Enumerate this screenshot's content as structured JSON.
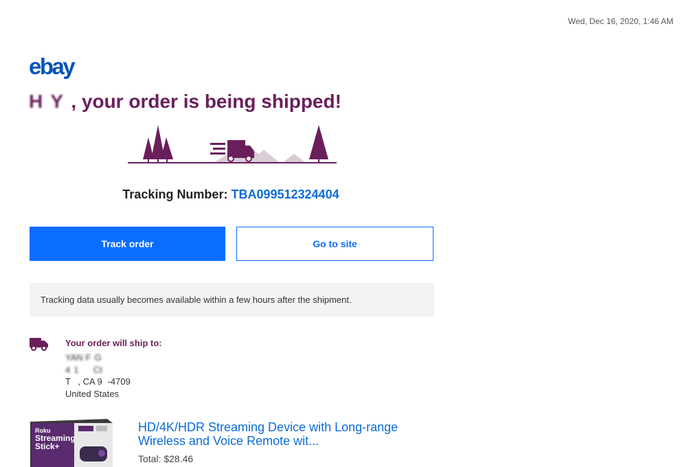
{
  "timestamp": "Wed, Dec 16, 2020, 1:46 AM",
  "brand": {
    "logo_text": "ebay",
    "logo_color": "#0654ba"
  },
  "headline": {
    "name_redacted": "H  Y  ",
    "text": ", your order is being shipped!",
    "color": "#6b1e5c"
  },
  "tracking": {
    "label": "Tracking Number:",
    "number": "TBA099512324404"
  },
  "buttons": {
    "track_order": "Track order",
    "go_to_site": "Go to site"
  },
  "notice": {
    "text": "Tracking data usually becomes available within a few hours after the shipment."
  },
  "shipping": {
    "title": "Your order will ship to:",
    "icon": "truck-icon",
    "address_lines": [
      "YAN F  G",
      "4  1       Ct",
      "T    , CA 9   -4709",
      "United States"
    ]
  },
  "product": {
    "image_text": "Roku Streaming Stick+",
    "title": "HD/4K/HDR Streaming Device with Long-range Wireless and Voice Remote wit...",
    "total": "Total: $28.46"
  }
}
